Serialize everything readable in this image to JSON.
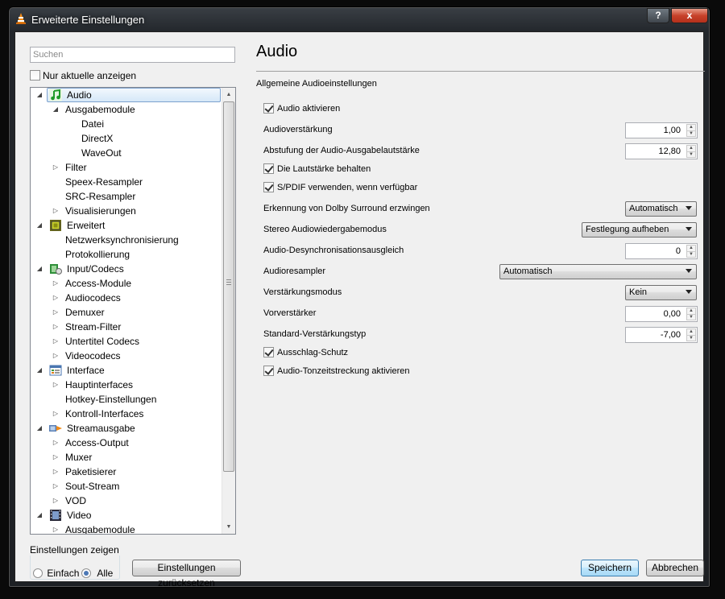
{
  "window": {
    "title": "Erweiterte Einstellungen",
    "help_label": "?",
    "close_label": "x"
  },
  "sidebar": {
    "search_placeholder": "Suchen",
    "only_current_label": "Nur aktuelle anzeigen",
    "tree": [
      {
        "label": "Audio",
        "level": 0,
        "arrow": "open",
        "icon": "audio-note-icon",
        "selected": true
      },
      {
        "label": "Ausgabemodule",
        "level": 1,
        "arrow": "open"
      },
      {
        "label": "Datei",
        "level": 2,
        "arrow": "none"
      },
      {
        "label": "DirectX",
        "level": 2,
        "arrow": "none"
      },
      {
        "label": "WaveOut",
        "level": 2,
        "arrow": "none"
      },
      {
        "label": "Filter",
        "level": 1,
        "arrow": "closed"
      },
      {
        "label": "Speex-Resampler",
        "level": 1,
        "arrow": "none"
      },
      {
        "label": "SRC-Resampler",
        "level": 1,
        "arrow": "none"
      },
      {
        "label": "Visualisierungen",
        "level": 1,
        "arrow": "closed"
      },
      {
        "label": "Erweitert",
        "level": 0,
        "arrow": "open",
        "icon": "chip-icon"
      },
      {
        "label": "Netzwerksynchronisierung",
        "level": 1,
        "arrow": "none"
      },
      {
        "label": "Protokollierung",
        "level": 1,
        "arrow": "none"
      },
      {
        "label": "Input/Codecs",
        "level": 0,
        "arrow": "open",
        "icon": "codec-icon"
      },
      {
        "label": "Access-Module",
        "level": 1,
        "arrow": "closed"
      },
      {
        "label": "Audiocodecs",
        "level": 1,
        "arrow": "closed"
      },
      {
        "label": "Demuxer",
        "level": 1,
        "arrow": "closed"
      },
      {
        "label": "Stream-Filter",
        "level": 1,
        "arrow": "closed"
      },
      {
        "label": "Untertitel Codecs",
        "level": 1,
        "arrow": "closed"
      },
      {
        "label": "Videocodecs",
        "level": 1,
        "arrow": "closed"
      },
      {
        "label": "Interface",
        "level": 0,
        "arrow": "open",
        "icon": "interface-icon"
      },
      {
        "label": "Hauptinterfaces",
        "level": 1,
        "arrow": "closed"
      },
      {
        "label": "Hotkey-Einstellungen",
        "level": 1,
        "arrow": "none"
      },
      {
        "label": "Kontroll-Interfaces",
        "level": 1,
        "arrow": "closed"
      },
      {
        "label": "Streamausgabe",
        "level": 0,
        "arrow": "open",
        "icon": "stream-icon"
      },
      {
        "label": "Access-Output",
        "level": 1,
        "arrow": "closed"
      },
      {
        "label": "Muxer",
        "level": 1,
        "arrow": "closed"
      },
      {
        "label": "Paketisierer",
        "level": 1,
        "arrow": "closed"
      },
      {
        "label": "Sout-Stream",
        "level": 1,
        "arrow": "closed"
      },
      {
        "label": "VOD",
        "level": 1,
        "arrow": "closed"
      },
      {
        "label": "Video",
        "level": 0,
        "arrow": "open",
        "icon": "film-icon"
      },
      {
        "label": "Ausgabemodule",
        "level": 1,
        "arrow": "closed"
      }
    ]
  },
  "show_settings": {
    "title": "Einstellungen zeigen",
    "simple_label": "Einfach",
    "all_label": "Alle",
    "selected": "Alle"
  },
  "buttons": {
    "reset": "Einstellungen zurücksetzen",
    "save": "Speichern",
    "cancel": "Abbrechen"
  },
  "panel": {
    "title": "Audio",
    "subtitle": "Allgemeine Audioeinstellungen",
    "options": [
      {
        "label": "Audio aktivieren",
        "kind": "checkbox",
        "checked": true
      },
      {
        "label": "Audioverstärkung",
        "kind": "spin",
        "value": "1,00"
      },
      {
        "label": "Abstufung der Audio-Ausgabelautstärke",
        "kind": "spin",
        "value": "12,80"
      },
      {
        "label": "Die Lautstärke behalten",
        "kind": "checkbox",
        "checked": true
      },
      {
        "label": "S/PDIF verwenden, wenn verfügbar",
        "kind": "checkbox",
        "checked": true
      },
      {
        "label": "Erkennung von Dolby Surround erzwingen",
        "kind": "combo",
        "value": "Automatisch"
      },
      {
        "label": "Stereo Audiowiedergabemodus",
        "kind": "combo",
        "value": "Festlegung aufheben"
      },
      {
        "label": "Audio-Desynchronisationsausgleich",
        "kind": "spin",
        "value": "0"
      },
      {
        "label": "Audioresampler",
        "kind": "combo",
        "value": "Automatisch"
      },
      {
        "label": "Verstärkungsmodus",
        "kind": "combo",
        "value": "Kein"
      },
      {
        "label": "Vorverstärker",
        "kind": "spin",
        "value": "0,00"
      },
      {
        "label": "Standard-Verstärkungstyp",
        "kind": "spin",
        "value": "-7,00"
      },
      {
        "label": "Ausschlag-Schutz",
        "kind": "checkbox",
        "checked": true
      },
      {
        "label": "Audio-Tonzeitstreckung aktivieren",
        "kind": "checkbox",
        "checked": true
      }
    ]
  }
}
